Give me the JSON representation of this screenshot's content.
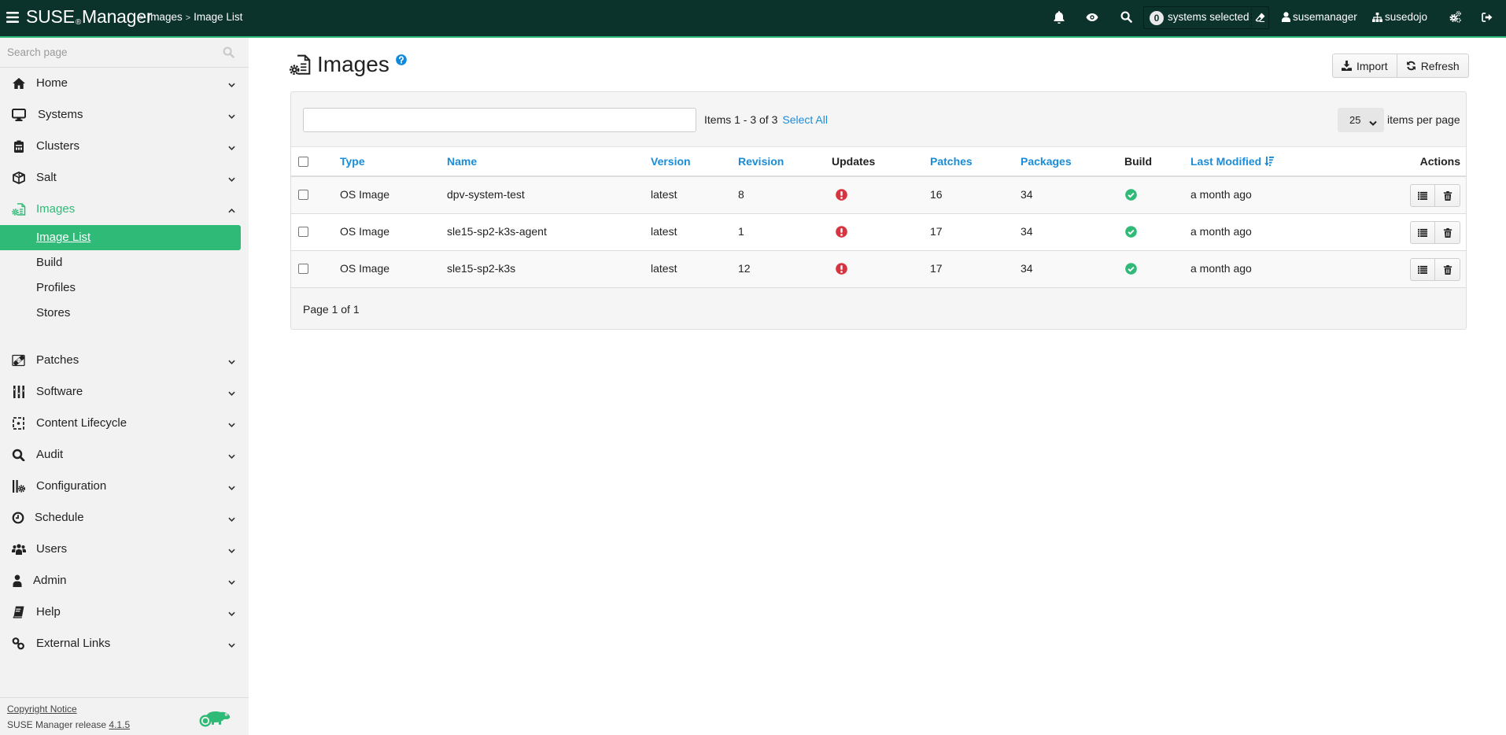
{
  "colors": {
    "header_bg": "#0c322c",
    "accent_green": "#30ba78",
    "link_blue": "#1a8cd8",
    "danger_red": "#d9333f",
    "sidebar_bg": "#f2f2f2"
  },
  "header": {
    "brand_left": "SUSE",
    "brand_reg": "®",
    "brand_right": "Manager",
    "breadcrumb_separator": ">",
    "breadcrumb": [
      "Images",
      "Image List"
    ],
    "systems_selected_count": "0",
    "systems_selected_label": "systems selected",
    "username": "susemanager",
    "organization": "susedojo",
    "icons": [
      "bars-icon",
      "bell-icon",
      "eye-icon",
      "search-icon",
      "eraser-icon",
      "user-icon",
      "sitemap-icon",
      "cogs-icon",
      "sign-out-icon"
    ]
  },
  "sidebar": {
    "search_placeholder": "Search page",
    "items": [
      {
        "label": "Home",
        "icon": "home-icon"
      },
      {
        "label": "Systems",
        "icon": "desktop-icon"
      },
      {
        "label": "Clusters",
        "icon": "clusters-icon"
      },
      {
        "label": "Salt",
        "icon": "cubes-icon"
      },
      {
        "label": "Images",
        "icon": "images-icon",
        "expanded": true
      },
      {
        "label": "Patches",
        "icon": "bandaid-icon"
      },
      {
        "label": "Software",
        "icon": "software-icon"
      },
      {
        "label": "Content Lifecycle",
        "icon": "content-lifecycle-icon"
      },
      {
        "label": "Audit",
        "icon": "search-icon"
      },
      {
        "label": "Configuration",
        "icon": "configuration-icon"
      },
      {
        "label": "Schedule",
        "icon": "clock-icon"
      },
      {
        "label": "Users",
        "icon": "users-icon"
      },
      {
        "label": "Admin",
        "icon": "user-icon"
      },
      {
        "label": "Help",
        "icon": "book-icon"
      },
      {
        "label": "External Links",
        "icon": "link-icon"
      }
    ],
    "images_subitems": [
      {
        "label": "Image List",
        "active": true
      },
      {
        "label": "Build"
      },
      {
        "label": "Profiles"
      },
      {
        "label": "Stores"
      }
    ],
    "footer": {
      "copyright": "Copyright Notice",
      "release_text": "SUSE Manager release",
      "release_version": "4.1.5"
    }
  },
  "page": {
    "title": "Images",
    "import_label": "Import",
    "refresh_label": "Refresh"
  },
  "list": {
    "filter_value": "",
    "items_summary": "Items 1 - 3 of 3",
    "select_all_label": "Select All",
    "per_page_value": "25",
    "per_page_label": "items per page",
    "sorted_by": "Last Modified",
    "sort_direction": "descending",
    "columns": [
      {
        "label": "Type",
        "sortable": true
      },
      {
        "label": "Name",
        "sortable": true
      },
      {
        "label": "Version",
        "sortable": true
      },
      {
        "label": "Revision",
        "sortable": true
      },
      {
        "label": "Updates",
        "sortable": false
      },
      {
        "label": "Patches",
        "sortable": true
      },
      {
        "label": "Packages",
        "sortable": true
      },
      {
        "label": "Build",
        "sortable": false
      },
      {
        "label": "Last Modified",
        "sortable": true
      },
      {
        "label": "Actions",
        "sortable": false
      }
    ],
    "rows": [
      {
        "type": "OS Image",
        "name": "dpv-system-test",
        "version": "latest",
        "revision": "8",
        "updates_status": "outdated",
        "patches": "16",
        "packages": "34",
        "build_status": "success",
        "last_modified": "a month ago"
      },
      {
        "type": "OS Image",
        "name": "sle15-sp2-k3s-agent",
        "version": "latest",
        "revision": "1",
        "updates_status": "outdated",
        "patches": "17",
        "packages": "34",
        "build_status": "success",
        "last_modified": "a month ago"
      },
      {
        "type": "OS Image",
        "name": "sle15-sp2-k3s",
        "version": "latest",
        "revision": "12",
        "updates_status": "outdated",
        "patches": "17",
        "packages": "34",
        "build_status": "success",
        "last_modified": "a month ago"
      }
    ],
    "pagination": "Page 1 of 1"
  }
}
